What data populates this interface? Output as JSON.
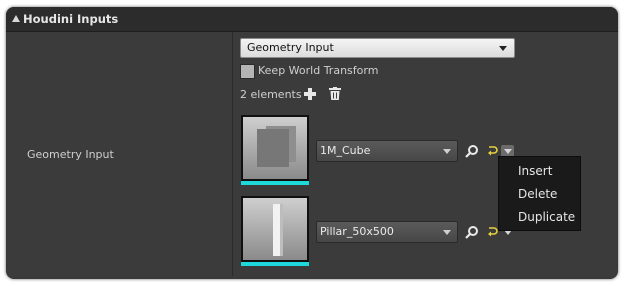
{
  "panel": {
    "title": "Houdini Inputs",
    "property_label": "Geometry Input"
  },
  "input_type": {
    "selected": "Geometry Input"
  },
  "keep_world_transform": {
    "label": "Keep World Transform",
    "checked": false
  },
  "elements": {
    "count_label": "2 elements",
    "items": [
      {
        "asset_name": "1M_Cube",
        "thumbnail": "cube"
      },
      {
        "asset_name": "Pillar_50x500",
        "thumbnail": "pillar"
      }
    ]
  },
  "context_menu": {
    "items": [
      "Insert",
      "Delete",
      "Duplicate"
    ]
  },
  "colors": {
    "panel_bg": "#3a3a3a",
    "title_bg": "#2c2c2c",
    "thumbnail_accent": "#1ed9d9",
    "reset_icon": "#e6d23c",
    "menu_bg": "#1a1a1a"
  },
  "icons": [
    "collapse-arrow-icon",
    "add-icon",
    "trash-icon",
    "browse-icon",
    "reset-icon",
    "chevron-down-icon"
  ]
}
